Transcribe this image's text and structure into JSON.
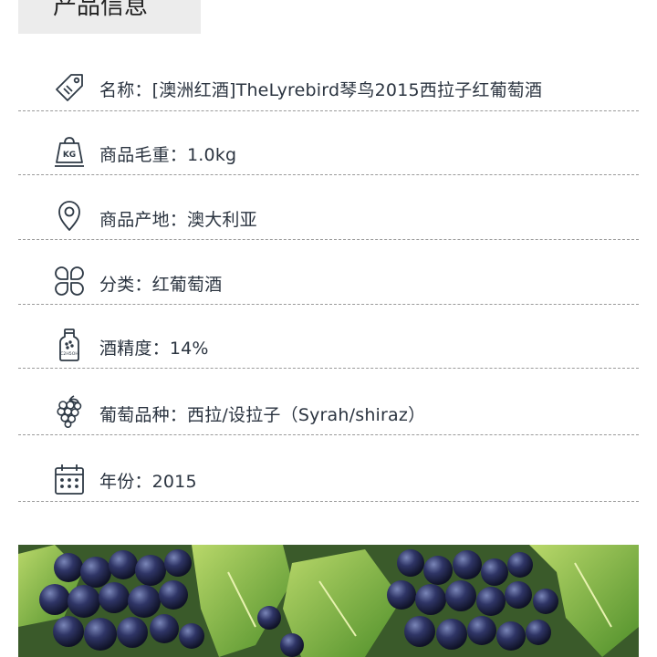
{
  "header": {
    "title": "产品信息"
  },
  "info_rows": [
    {
      "icon": "price-tag-icon",
      "label": "名称：",
      "value": "[澳洲红酒]TheLyrebird琴鸟2015西拉子红葡萄酒"
    },
    {
      "icon": "weight-kg-icon",
      "label": "商品毛重：",
      "value": "1.0kg"
    },
    {
      "icon": "location-pin-icon",
      "label": "商品产地：",
      "value": "澳大利亚"
    },
    {
      "icon": "category-grid-icon",
      "label": "分类：",
      "value": "红葡萄酒"
    },
    {
      "icon": "alcohol-bottle-icon",
      "label": "酒精度：",
      "value": "14%"
    },
    {
      "icon": "grape-icon",
      "label": "葡萄品种：",
      "value": "西拉/设拉子（Syrah/shiraz）"
    },
    {
      "icon": "calendar-icon",
      "label": "年份：",
      "value": "2015"
    }
  ],
  "icon_texts": {
    "weight": "KG",
    "bottle": "C2H5OH"
  },
  "colors": {
    "icon_stroke": "#2f3a46",
    "divider": "#9a9a9a",
    "header_bg": "#ececec",
    "text": "#2b3440"
  }
}
